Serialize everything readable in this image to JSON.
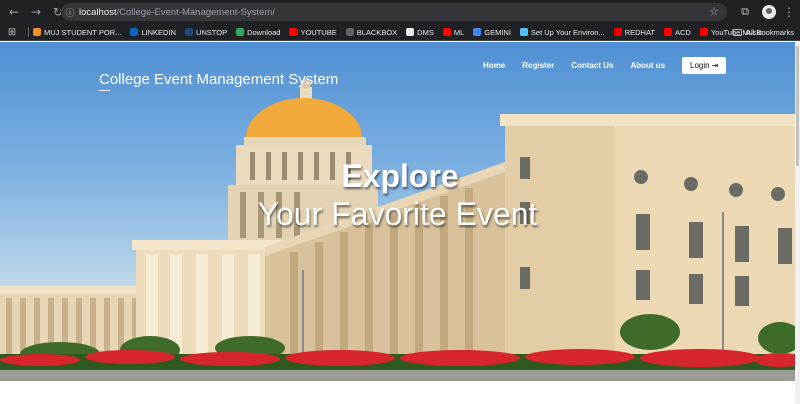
{
  "browser": {
    "url_host": "localhost",
    "url_path": "/College-Event-Management-System/",
    "bookmarks": [
      {
        "label": "MUJ STUDENT POR...",
        "color": "#f28b2c"
      },
      {
        "label": "LINKEDIN",
        "color": "#0a66c2"
      },
      {
        "label": "UNSTOP",
        "color": "#1c4980"
      },
      {
        "label": "Download",
        "color": "#34a853"
      },
      {
        "label": "YOUTUBE",
        "color": "#ff0000"
      },
      {
        "label": "BLACKBOX",
        "color": "#5f6368"
      },
      {
        "label": "DMS",
        "color": "#e8eaed"
      },
      {
        "label": "ML",
        "color": "#ff0000"
      },
      {
        "label": "GEMINI",
        "color": "#4285f4"
      },
      {
        "label": "Set Up Your Environ...",
        "color": "#4fc3f7"
      },
      {
        "label": "REDHAT",
        "color": "#ee0000"
      },
      {
        "label": "ACD",
        "color": "#ff0000"
      },
      {
        "label": "YouTube Music",
        "color": "#ff0000"
      }
    ],
    "all_bookmarks": "All Bookmarks"
  },
  "site": {
    "brand": "College Event Management System",
    "nav": [
      "Home",
      "Register",
      "Contact Us",
      "About us"
    ],
    "login": "Login"
  },
  "hero": {
    "line1": "Explore",
    "line2": "Your Favorite Event"
  }
}
